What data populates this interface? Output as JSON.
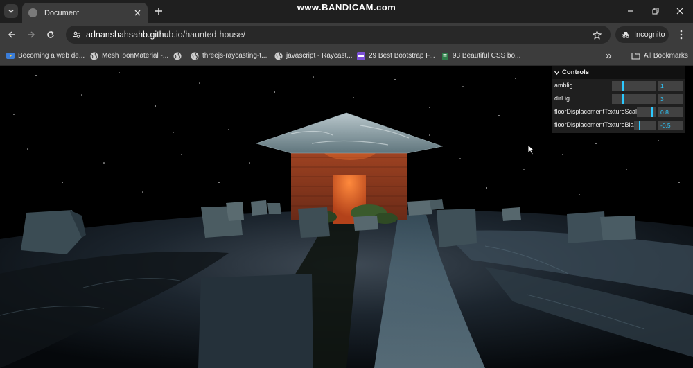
{
  "browser": {
    "watermark": "www.BANDICAM.com",
    "tab": {
      "title": "Document"
    },
    "address": {
      "url_host": "adnanshahsahb.github.io",
      "url_path": "/haunted-house/"
    },
    "incognito_label": "Incognito",
    "bookmarks": [
      {
        "label": "Becoming a web de...",
        "icon": "youtube-icon"
      },
      {
        "label": "MeshToonMaterial -...",
        "icon": "globe-icon"
      },
      {
        "label": "",
        "icon": "globe-icon"
      },
      {
        "label": "threejs-raycasting-t...",
        "icon": "globe-icon"
      },
      {
        "label": "javascript - Raycast...",
        "icon": "globe-icon"
      },
      {
        "label": "29 Best Bootstrap F...",
        "icon": "colorlib-icon"
      },
      {
        "label": "93 Beautiful CSS bo...",
        "icon": "page-icon"
      }
    ],
    "all_bookmarks_label": "All Bookmarks"
  },
  "gui": {
    "title": "Controls",
    "controls": [
      {
        "label": "amblig",
        "value": "1",
        "fill": 0.25
      },
      {
        "label": "dirLig",
        "value": "3",
        "fill": 0.25
      },
      {
        "label": "floorDisplacementTextureScale",
        "value": "0.8",
        "fill": 0.8
      },
      {
        "label": "floorDisplacementTextureBias",
        "value": "-0.5",
        "fill": 0.25
      }
    ]
  },
  "colors": {
    "accent": "#2cc9ff",
    "chrome_bg": "#3c3c3c",
    "titlebar_bg": "#1f1f1f",
    "door_glow": "#ff6a2a"
  }
}
